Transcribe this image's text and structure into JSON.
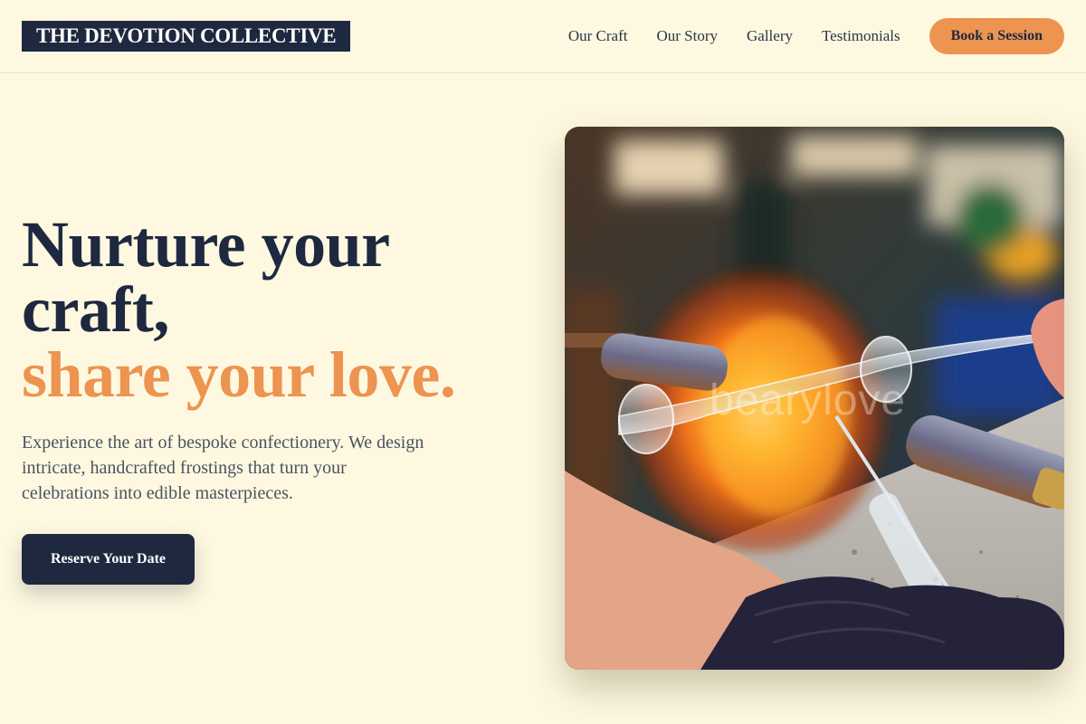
{
  "brand": {
    "name": "THE DEVOTION COLLECTIVE"
  },
  "nav": {
    "links": [
      "Our Craft",
      "Our Story",
      "Gallery",
      "Testimonials"
    ],
    "cta": "Book a Session"
  },
  "hero": {
    "title_line1": "Nurture your",
    "title_line2": "craft,",
    "title_accent": "share your love.",
    "description": "Experience the art of bespoke confectionery. We design intricate, handcrafted frostings that turn your celebrations into edible masterpieces.",
    "cta": "Reserve Your Date",
    "image": {
      "subject": "hands shaping a glass tube over a torch flame",
      "watermark": "bearylove"
    }
  },
  "colors": {
    "background": "#fef8e0",
    "navy": "#1e2940",
    "accent": "#ec9450",
    "body_text": "#4b5262"
  }
}
